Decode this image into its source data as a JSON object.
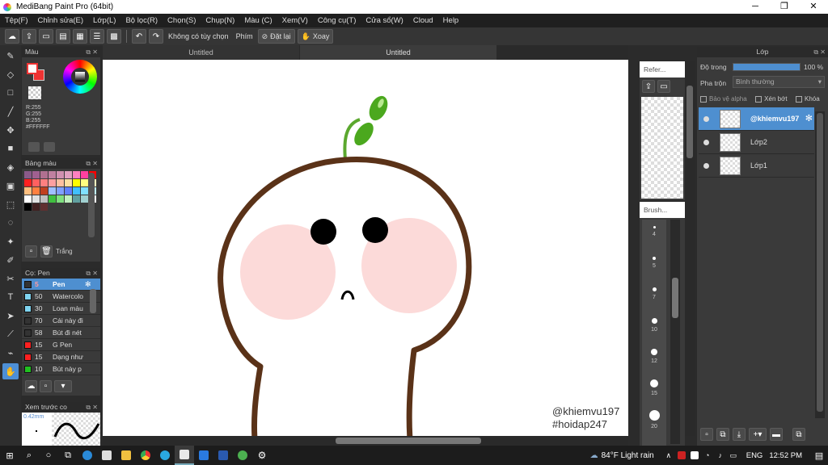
{
  "window": {
    "title": "MediBang Paint Pro (64bit)",
    "minimize": "─",
    "maximize": "❐",
    "close": "✕"
  },
  "menu": [
    "Tệp(F)",
    "Chỉnh sửa(E)",
    "Lớp(L)",
    "Bộ lọc(R)",
    "Chọn(S)",
    "Chụp(N)",
    "Màu (C)",
    "Xem(V)",
    "Công cụ(T)",
    "Cửa sổ(W)",
    "Cloud",
    "Help"
  ],
  "toolbar": {
    "no_options": "Không có tùy chọn",
    "key_label": "Phím",
    "reset_label": "Đặt lại",
    "rotate_label": "Xoay"
  },
  "tabs": [
    "Untitled",
    "Untitled"
  ],
  "color_panel": {
    "title": "Màu",
    "primary_color": "#ffffff",
    "secondary_color": "#ff0000",
    "r": "R:255",
    "g": "G:255",
    "b": "B:255",
    "hex": "#FFFFFF"
  },
  "palette_panel": {
    "title": "Bảng màu",
    "swatches": [
      "#8a5a8a",
      "#a06090",
      "#b07090",
      "#c080a0",
      "#d090b0",
      "#e0a0c0",
      "#ff80c0",
      "#ff40a0",
      "#ff0000",
      "#ff2020",
      "#ff6060",
      "#ff8080",
      "#ffa0a0",
      "#ffc0a0",
      "#ffe0a0",
      "#ffff00",
      "#ffff80",
      "#ffffc0",
      "#ffc080",
      "#ff8040",
      "#c04020",
      "#a0c0ff",
      "#80a0ff",
      "#6080ff",
      "#40c0ff",
      "#80e0ff",
      "#c0f0ff",
      "#ffffff",
      "#e0e0e0",
      "#c0c0c0",
      "#40c040",
      "#80e080",
      "#c0f0c0",
      "#60a0a0",
      "#a0d0d0",
      "#ffffff",
      "#000000",
      "#402020",
      "#603030"
    ],
    "swatch_label": "Trắng"
  },
  "brush_panel": {
    "title": "Cọ: Pen",
    "items": [
      {
        "color": "#333333",
        "size": "5",
        "name": "Pen",
        "selected": true
      },
      {
        "color": "#7fd4f0",
        "size": "50",
        "name": "Watercolor",
        "selected": false
      },
      {
        "color": "#7fd4f0",
        "size": "30",
        "name": "Loan màu",
        "selected": false
      },
      {
        "color": "#333333",
        "size": "70",
        "name": "Cái này đi",
        "selected": false
      },
      {
        "color": "#333333",
        "size": "58",
        "name": "Bút đi nét",
        "selected": false
      },
      {
        "color": "#ff2020",
        "size": "15",
        "name": "G Pen",
        "selected": false
      },
      {
        "color": "#ff2020",
        "size": "15",
        "name": "Dạng như",
        "selected": false
      },
      {
        "color": "#20c020",
        "size": "10",
        "name": "Bút này p",
        "selected": false
      }
    ]
  },
  "preview_panel": {
    "title": "Xem trước co",
    "size_label": "0.42mm"
  },
  "reference_panel": {
    "title": "Refer..."
  },
  "brushsize_panel": {
    "title": "Brush...",
    "sizes": [
      "4",
      "5",
      "7",
      "10",
      "12",
      "15",
      "20"
    ]
  },
  "layer_panel": {
    "title": "Lớp",
    "opacity_label": "Độ trong",
    "opacity_value": "100 %",
    "opacity_fraction": 1.0,
    "blend_label": "Pha trộn",
    "blend_value": "Bình thường",
    "protect_alpha": "Bảo vệ alpha",
    "clipping": "Xén bớt",
    "lock": "Khóa",
    "layers": [
      {
        "name": "@khiemvu197",
        "selected": true
      },
      {
        "name": "Lớp2",
        "selected": false
      },
      {
        "name": "Lớp1",
        "selected": false
      }
    ]
  },
  "canvas": {
    "watermark_line1": "@khiemvu197",
    "watermark_line2": "#hoidap247"
  },
  "taskbar": {
    "weather": "84°F  Light rain",
    "language": "ENG",
    "time": "12:52 PM"
  }
}
